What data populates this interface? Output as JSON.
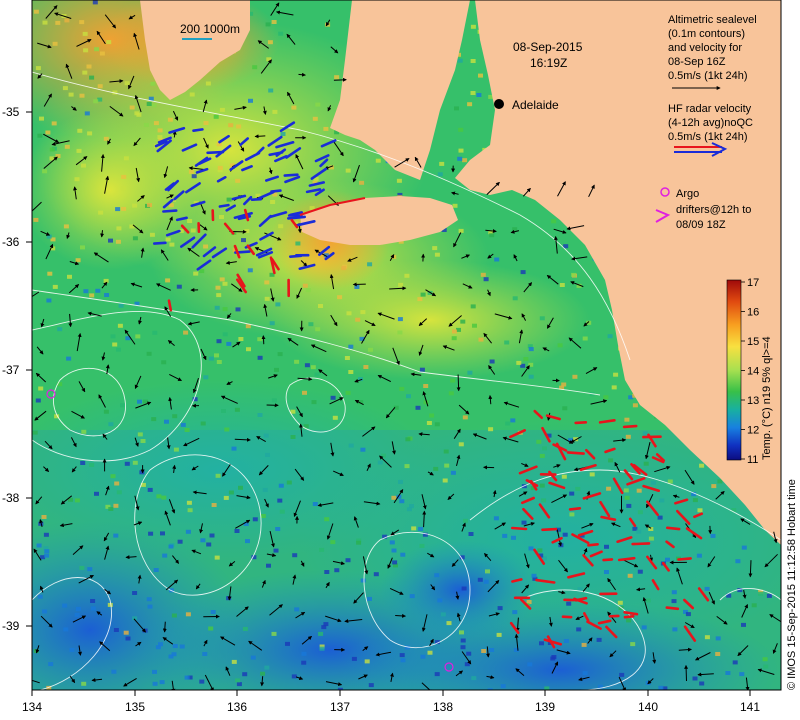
{
  "map": {
    "date": "08-Sep-2015",
    "time": "16:19Z",
    "scale_label": "200  1000m",
    "city": "Adelaide",
    "lon_ticks": [
      "134",
      "135",
      "136",
      "137",
      "138",
      "139",
      "140",
      "141"
    ],
    "lat_ticks": [
      "-35",
      "-36",
      "-37",
      "-38",
      "-39"
    ],
    "footer": "© IMOS 15-Sep-2015 11:12:58 Hobart time",
    "colors": {
      "land": "#f8c49a",
      "ocean": "#36c06a",
      "hf_red": "#e8141c",
      "hf_blue": "#1a2cd8",
      "argo": "#e020e0"
    }
  },
  "legend": {
    "altimetry": {
      "line1": "Altimetric sealevel",
      "line2": "(0.1m contours)",
      "line3": "and velocity for",
      "line4": "08-Sep 16Z",
      "line5": "0.5m/s (1kt 24h)"
    },
    "hf": {
      "line1": "HF radar velocity",
      "line2": "(4-12h avg)noQC",
      "line3": "0.5m/s (1kt 24h)"
    },
    "argo": {
      "line1": "Argo",
      "line2": "drifters@12h to",
      "line3": "08/09 18Z"
    }
  },
  "colorbar": {
    "ticks": [
      "17",
      "16",
      "15",
      "14",
      "13",
      "12",
      "11"
    ],
    "label": "Temp. (°C) n19 5% ql>=4",
    "colors": [
      "#b01010",
      "#e85010",
      "#f8a020",
      "#f8e040",
      "#a8e050",
      "#38c048",
      "#18b0a0",
      "#1880e0",
      "#1030c0",
      "#101090"
    ]
  }
}
